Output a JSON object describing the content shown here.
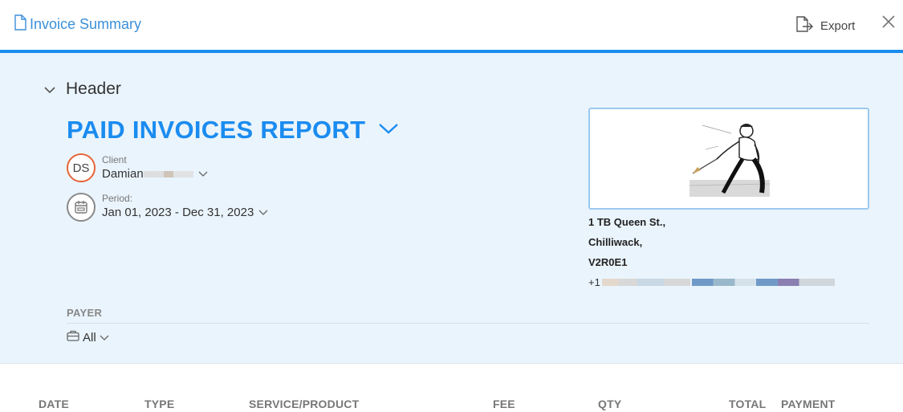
{
  "window": {
    "title": "Invoice Summary",
    "export_label": "Export"
  },
  "header_section": {
    "label": "Header",
    "report_title": "PAID INVOICES REPORT"
  },
  "client": {
    "label": "Client",
    "initials": "DS",
    "name": "Damian"
  },
  "period": {
    "label": "Period:",
    "value": "Jan 01, 2023 - Dec 31, 2023"
  },
  "business": {
    "address_line1": "1 TB Queen St.,",
    "address_line2": "Chilliwack,",
    "address_line3": "V2R0E1",
    "phone_prefix": "+1"
  },
  "payer": {
    "label": "PAYER",
    "value": "All"
  },
  "table": {
    "columns": [
      "DATE",
      "TYPE",
      "SERVICE/PRODUCT",
      "FEE",
      "QTY",
      "TOTAL",
      "PAYMENT"
    ]
  },
  "colors": {
    "accent": "#1a8cf0",
    "panel_bg": "#eaf4fc",
    "avatar_border": "#e8643c"
  },
  "icons": {
    "title": "document-icon",
    "export": "export-icon",
    "close": "close-icon",
    "section_toggle": "chevron-down-icon",
    "period": "calendar-icon",
    "payer": "briefcase-icon"
  }
}
